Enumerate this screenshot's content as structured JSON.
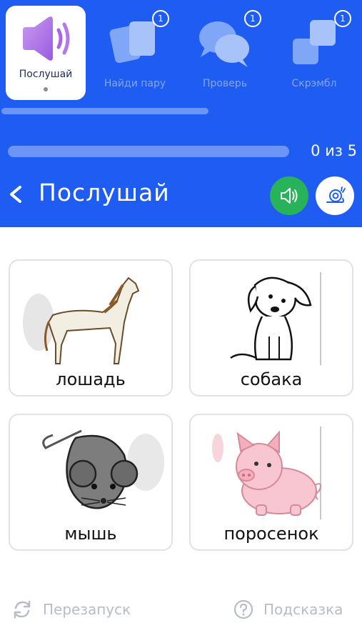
{
  "modes": [
    {
      "label": "Послушай",
      "icon": "speaker-icon",
      "active": true
    },
    {
      "label": "Найди пару",
      "icon": "cards-icon",
      "badge": "1"
    },
    {
      "label": "Проверь",
      "icon": "chat-bubbles-icon",
      "badge": "1"
    },
    {
      "label": "Скрэмбл",
      "icon": "squares-icon",
      "badge": "1"
    }
  ],
  "progress": {
    "text": "0 из 5",
    "fraction": 0.0
  },
  "header": {
    "title": "Послушай"
  },
  "cards": [
    {
      "word": "лошадь",
      "image": "horse"
    },
    {
      "word": "собака",
      "image": "dog"
    },
    {
      "word": "мышь",
      "image": "mouse"
    },
    {
      "word": "поросенок",
      "image": "pig"
    }
  ],
  "footer": {
    "restart_label": "Перезапуск",
    "hint_label": "Подсказка"
  },
  "colors": {
    "brand_blue": "#1e5cf2",
    "sound_green": "#28b35b"
  }
}
